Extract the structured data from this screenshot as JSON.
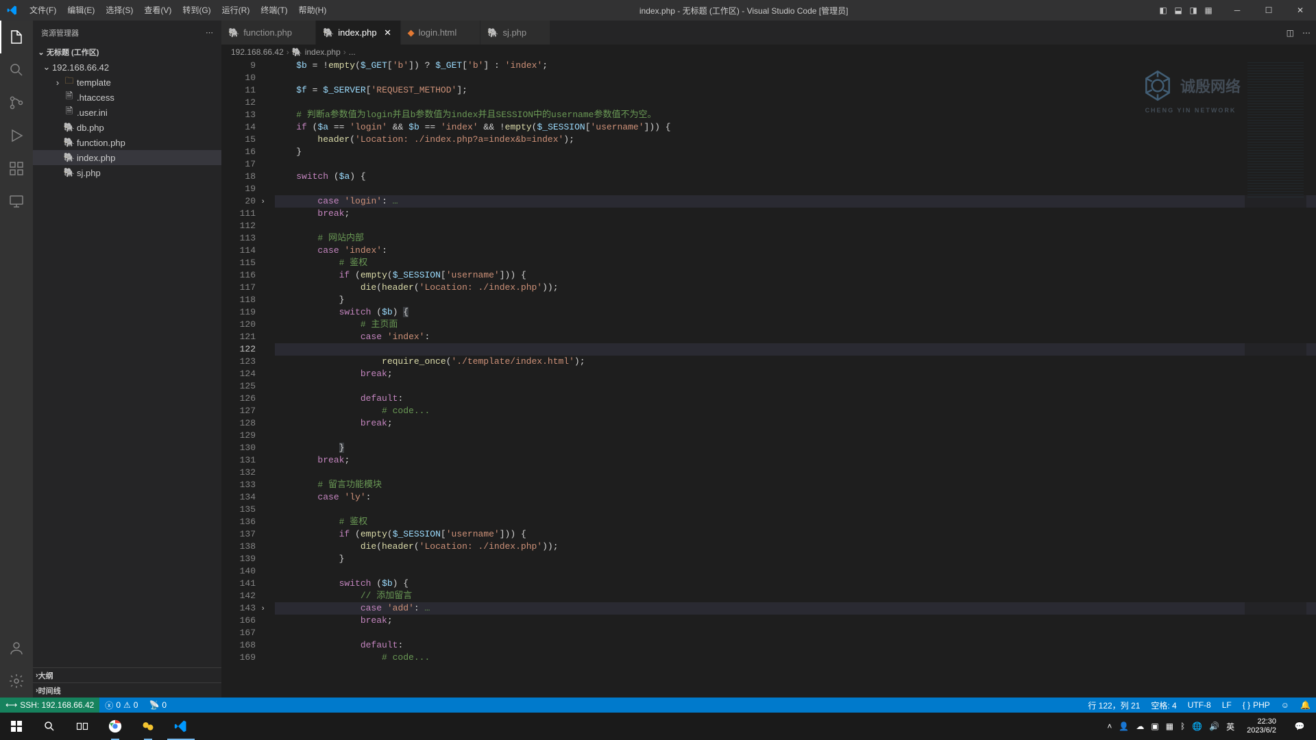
{
  "titlebar": {
    "menus": [
      "文件(F)",
      "编辑(E)",
      "选择(S)",
      "查看(V)",
      "转到(G)",
      "运行(R)",
      "终端(T)",
      "帮助(H)"
    ],
    "title": "index.php - 无标题 (工作区) - Visual Studio Code [管理员]"
  },
  "sidebar": {
    "header": "资源管理器",
    "workspace": "无标题 (工作区)",
    "root": "192.168.66.42",
    "files": [
      {
        "name": "template",
        "type": "folder",
        "indent": 2
      },
      {
        "name": ".htaccess",
        "type": "file",
        "indent": 2
      },
      {
        "name": ".user.ini",
        "type": "file",
        "indent": 2
      },
      {
        "name": "db.php",
        "type": "php",
        "indent": 2
      },
      {
        "name": "function.php",
        "type": "php",
        "indent": 2
      },
      {
        "name": "index.php",
        "type": "php",
        "indent": 2,
        "selected": true
      },
      {
        "name": "sj.php",
        "type": "php",
        "indent": 2
      }
    ],
    "outline": "大纲",
    "timeline": "时间线"
  },
  "tabs": [
    {
      "label": "function.php",
      "icon": "php"
    },
    {
      "label": "index.php",
      "icon": "php",
      "active": true
    },
    {
      "label": "login.html",
      "icon": "html"
    },
    {
      "label": "sj.php",
      "icon": "php"
    }
  ],
  "breadcrumb": {
    "parts": [
      "192.168.66.42",
      "index.php",
      "..."
    ]
  },
  "code": {
    "lines": [
      {
        "n": 9,
        "html": "<span class='var'>$b</span> <span class='op'>=</span> <span class='op'>!</span><span class='fn'>empty</span><span class='pun'>(</span><span class='var'>$_GET</span><span class='pun'>[</span><span class='str'>'b'</span><span class='pun'>])</span> <span class='op'>?</span> <span class='var'>$_GET</span><span class='pun'>[</span><span class='str'>'b'</span><span class='pun'>]</span> <span class='op'>:</span> <span class='str'>'index'</span><span class='pun'>;</span>",
        "indent": 1
      },
      {
        "n": 10,
        "html": "",
        "indent": 1
      },
      {
        "n": 11,
        "html": "<span class='var'>$f</span> <span class='op'>=</span> <span class='var'>$_SERVER</span><span class='pun'>[</span><span class='str'>'REQUEST_METHOD'</span><span class='pun'>];</span>",
        "indent": 1
      },
      {
        "n": 12,
        "html": "",
        "indent": 1
      },
      {
        "n": 13,
        "html": "<span class='cmt'># 判断a参数值为login并且b参数值为index并且SESSION中的username参数值不为空。</span>",
        "indent": 1
      },
      {
        "n": 14,
        "html": "<span class='kw'>if</span> <span class='pun'>(</span><span class='var'>$a</span> <span class='op'>==</span> <span class='str'>'login'</span> <span class='op'>&amp;&amp;</span> <span class='var'>$b</span> <span class='op'>==</span> <span class='str'>'index'</span> <span class='op'>&amp;&amp;</span> <span class='op'>!</span><span class='fn'>empty</span><span class='pun'>(</span><span class='var'>$_SESSION</span><span class='pun'>[</span><span class='str'>'username'</span><span class='pun'>]))</span> <span class='pun'>{</span>",
        "indent": 1
      },
      {
        "n": 15,
        "html": "<span class='fn'>header</span><span class='pun'>(</span><span class='str'>'Location: ./index.php?a=index&amp;b=index'</span><span class='pun'>);</span>",
        "indent": 2
      },
      {
        "n": 16,
        "html": "<span class='pun'>}</span>",
        "indent": 1
      },
      {
        "n": 17,
        "html": "",
        "indent": 1
      },
      {
        "n": 18,
        "html": "<span class='kw'>switch</span> <span class='pun'>(</span><span class='var'>$a</span><span class='pun'>)</span> <span class='pun'>{</span>",
        "indent": 1
      },
      {
        "n": 19,
        "html": "",
        "indent": 1
      },
      {
        "n": 20,
        "html": "<span class='kw'>case</span> <span class='str'>'login'</span><span class='pun'>:</span><span class='cmt'> …</span>",
        "indent": 2,
        "fold": true,
        "hl": true
      },
      {
        "n": 111,
        "html": "<span class='kw'>break</span><span class='pun'>;</span>",
        "indent": 2
      },
      {
        "n": 112,
        "html": "",
        "indent": 2
      },
      {
        "n": 113,
        "html": "<span class='cmt'># 网站内部</span>",
        "indent": 2
      },
      {
        "n": 114,
        "html": "<span class='kw'>case</span> <span class='str'>'index'</span><span class='pun'>:</span>",
        "indent": 2
      },
      {
        "n": 115,
        "html": "<span class='cmt'># 鉴权</span>",
        "indent": 3
      },
      {
        "n": 116,
        "html": "<span class='kw'>if</span> <span class='pun'>(</span><span class='fn'>empty</span><span class='pun'>(</span><span class='var'>$_SESSION</span><span class='pun'>[</span><span class='str'>'username'</span><span class='pun'>]))</span> <span class='pun'>{</span>",
        "indent": 3
      },
      {
        "n": 117,
        "html": "<span class='fn'>die</span><span class='pun'>(</span><span class='fn'>header</span><span class='pun'>(</span><span class='str'>'Location: ./index.php'</span><span class='pun'>));</span>",
        "indent": 4
      },
      {
        "n": 118,
        "html": "<span class='pun'>}</span>",
        "indent": 3
      },
      {
        "n": 119,
        "html": "<span class='kw'>switch</span> <span class='pun'>(</span><span class='var'>$b</span><span class='pun'>)</span> <span class='pun cursor-highlight'>{</span>",
        "indent": 3
      },
      {
        "n": 120,
        "html": "<span class='cmt'># 主页面</span>",
        "indent": 4
      },
      {
        "n": 121,
        "html": "<span class='kw'>case</span> <span class='str'>'index'</span><span class='pun'>:</span>",
        "indent": 4
      },
      {
        "n": 122,
        "html": "",
        "indent": 5,
        "current": true
      },
      {
        "n": 123,
        "html": "<span class='fn'>require_once</span><span class='pun'>(</span><span class='str'>'./template/index.html'</span><span class='pun'>);</span>",
        "indent": 5
      },
      {
        "n": 124,
        "html": "<span class='kw'>break</span><span class='pun'>;</span>",
        "indent": 4
      },
      {
        "n": 125,
        "html": "",
        "indent": 4
      },
      {
        "n": 126,
        "html": "<span class='kw'>default</span><span class='pun'>:</span>",
        "indent": 4
      },
      {
        "n": 127,
        "html": "<span class='cmt'># code...</span>",
        "indent": 5
      },
      {
        "n": 128,
        "html": "<span class='kw'>break</span><span class='pun'>;</span>",
        "indent": 4
      },
      {
        "n": 129,
        "html": "",
        "indent": 3
      },
      {
        "n": 130,
        "html": "<span class='pun cursor-highlight'>}</span>",
        "indent": 3
      },
      {
        "n": 131,
        "html": "<span class='kw'>break</span><span class='pun'>;</span>",
        "indent": 2
      },
      {
        "n": 132,
        "html": "",
        "indent": 2
      },
      {
        "n": 133,
        "html": "<span class='cmt'># 留言功能模块</span>",
        "indent": 2
      },
      {
        "n": 134,
        "html": "<span class='kw'>case</span> <span class='str'>'ly'</span><span class='pun'>:</span>",
        "indent": 2
      },
      {
        "n": 135,
        "html": "",
        "indent": 3
      },
      {
        "n": 136,
        "html": "<span class='cmt'># 鉴权</span>",
        "indent": 3
      },
      {
        "n": 137,
        "html": "<span class='kw'>if</span> <span class='pun'>(</span><span class='fn'>empty</span><span class='pun'>(</span><span class='var'>$_SESSION</span><span class='pun'>[</span><span class='str'>'username'</span><span class='pun'>]))</span> <span class='pun'>{</span>",
        "indent": 3
      },
      {
        "n": 138,
        "html": "<span class='fn'>die</span><span class='pun'>(</span><span class='fn'>header</span><span class='pun'>(</span><span class='str'>'Location: ./index.php'</span><span class='pun'>));</span>",
        "indent": 4
      },
      {
        "n": 139,
        "html": "<span class='pun'>}</span>",
        "indent": 3
      },
      {
        "n": 140,
        "html": "",
        "indent": 3
      },
      {
        "n": 141,
        "html": "<span class='kw'>switch</span> <span class='pun'>(</span><span class='var'>$b</span><span class='pun'>)</span> <span class='pun'>{</span>",
        "indent": 3
      },
      {
        "n": 142,
        "html": "<span class='cmt'>// 添加留言</span>",
        "indent": 4
      },
      {
        "n": 143,
        "html": "<span class='kw'>case</span> <span class='str'>'add'</span><span class='pun'>:</span><span class='cmt'> …</span>",
        "indent": 4,
        "fold": true,
        "hl": true
      },
      {
        "n": 166,
        "html": "<span class='kw'>break</span><span class='pun'>;</span>",
        "indent": 4
      },
      {
        "n": 167,
        "html": "",
        "indent": 4
      },
      {
        "n": 168,
        "html": "<span class='kw'>default</span><span class='pun'>:</span>",
        "indent": 4
      },
      {
        "n": 169,
        "html": "<span class='cmt'># code...</span>",
        "indent": 5
      }
    ]
  },
  "statusbar": {
    "remote": "SSH: 192.168.66.42",
    "errors": "0",
    "warnings": "0",
    "ports": "0",
    "cursor": "行 122，列 21",
    "spaces": "空格: 4",
    "encoding": "UTF-8",
    "eol": "LF",
    "lang": "PHP"
  },
  "taskbar": {
    "ime": "英",
    "time": "22:30",
    "date": "2023/6/2"
  },
  "watermark": {
    "main": "诚殷网络",
    "sub": "CHENG YIN NETWORK"
  }
}
